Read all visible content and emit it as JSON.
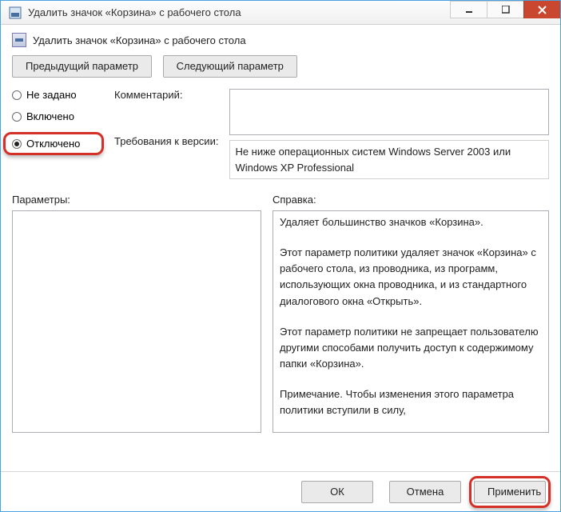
{
  "window": {
    "title": "Удалить значок «Корзина» с рабочего стола"
  },
  "header": {
    "text": "Удалить значок «Корзина» с рабочего стола"
  },
  "nav": {
    "prev": "Предыдущий параметр",
    "next": "Следующий параметр"
  },
  "radios": {
    "not_set": "Не задано",
    "enabled": "Включено",
    "disabled": "Отключено",
    "selected": "disabled"
  },
  "labels": {
    "comment": "Комментарий:",
    "requirements": "Требования к версии:",
    "parameters": "Параметры:",
    "help": "Справка:"
  },
  "comment_value": "",
  "requirements_text": "Не ниже операционных систем Windows Server 2003 или Windows XP Professional",
  "parameters_value": "",
  "help_paragraphs": [
    "Удаляет большинство значков «Корзина».",
    "Этот параметр политики удаляет значок «Корзина» с рабочего стола, из проводника, из программ, использующих окна проводника, и из стандартного диалогового окна «Открыть».",
    "Этот параметр политики не запрещает пользователю другими способами получить доступ к содержимому папки «Корзина».",
    "Примечание. Чтобы изменения этого параметра политики вступили в силу,"
  ],
  "footer": {
    "ok": "ОК",
    "cancel": "Отмена",
    "apply": "Применить"
  }
}
